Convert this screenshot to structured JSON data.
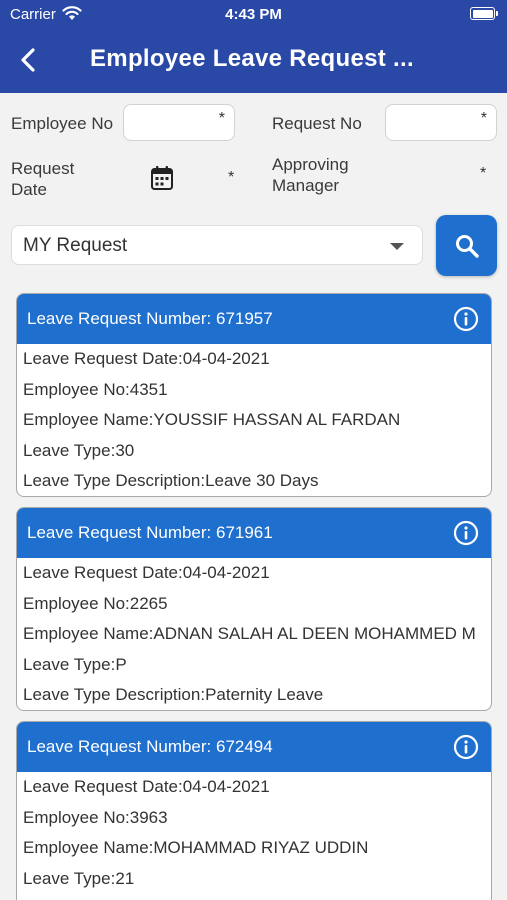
{
  "status_bar": {
    "carrier": "Carrier",
    "time": "4:43 PM"
  },
  "header": {
    "title": "Employee Leave Request ..."
  },
  "form": {
    "employee_no_label": "Employee No",
    "request_no_label": "Request No",
    "request_date_label_1": "Request",
    "request_date_label_2": "Date",
    "approving_manager_label_1": "Approving",
    "approving_manager_label_2": "Manager",
    "required_mark": "*"
  },
  "filter": {
    "selected": "MY Request"
  },
  "colors": {
    "header": "#2a49a7",
    "accent": "#1f6fcf"
  },
  "requests": [
    {
      "number": "Leave Request Number: 671957",
      "date": "Leave Request Date:04-04-2021",
      "employee_no": "Employee No:4351",
      "employee_name": "Employee Name:YOUSSIF HASSAN AL FARDAN",
      "leave_type": "Leave Type:30",
      "leave_type_desc": "Leave Type Description:Leave 30 Days"
    },
    {
      "number": "Leave Request Number: 671961",
      "date": "Leave Request Date:04-04-2021",
      "employee_no": "Employee No:2265",
      "employee_name": "Employee Name:ADNAN SALAH AL DEEN MOHAMMED M",
      "leave_type": "Leave Type:P",
      "leave_type_desc": "Leave Type Description:Paternity Leave"
    },
    {
      "number": "Leave Request Number: 672494",
      "date": "Leave Request Date:04-04-2021",
      "employee_no": "Employee No:3963",
      "employee_name": "Employee Name:MOHAMMAD RIYAZ UDDIN",
      "leave_type": "Leave Type:21"
    }
  ]
}
